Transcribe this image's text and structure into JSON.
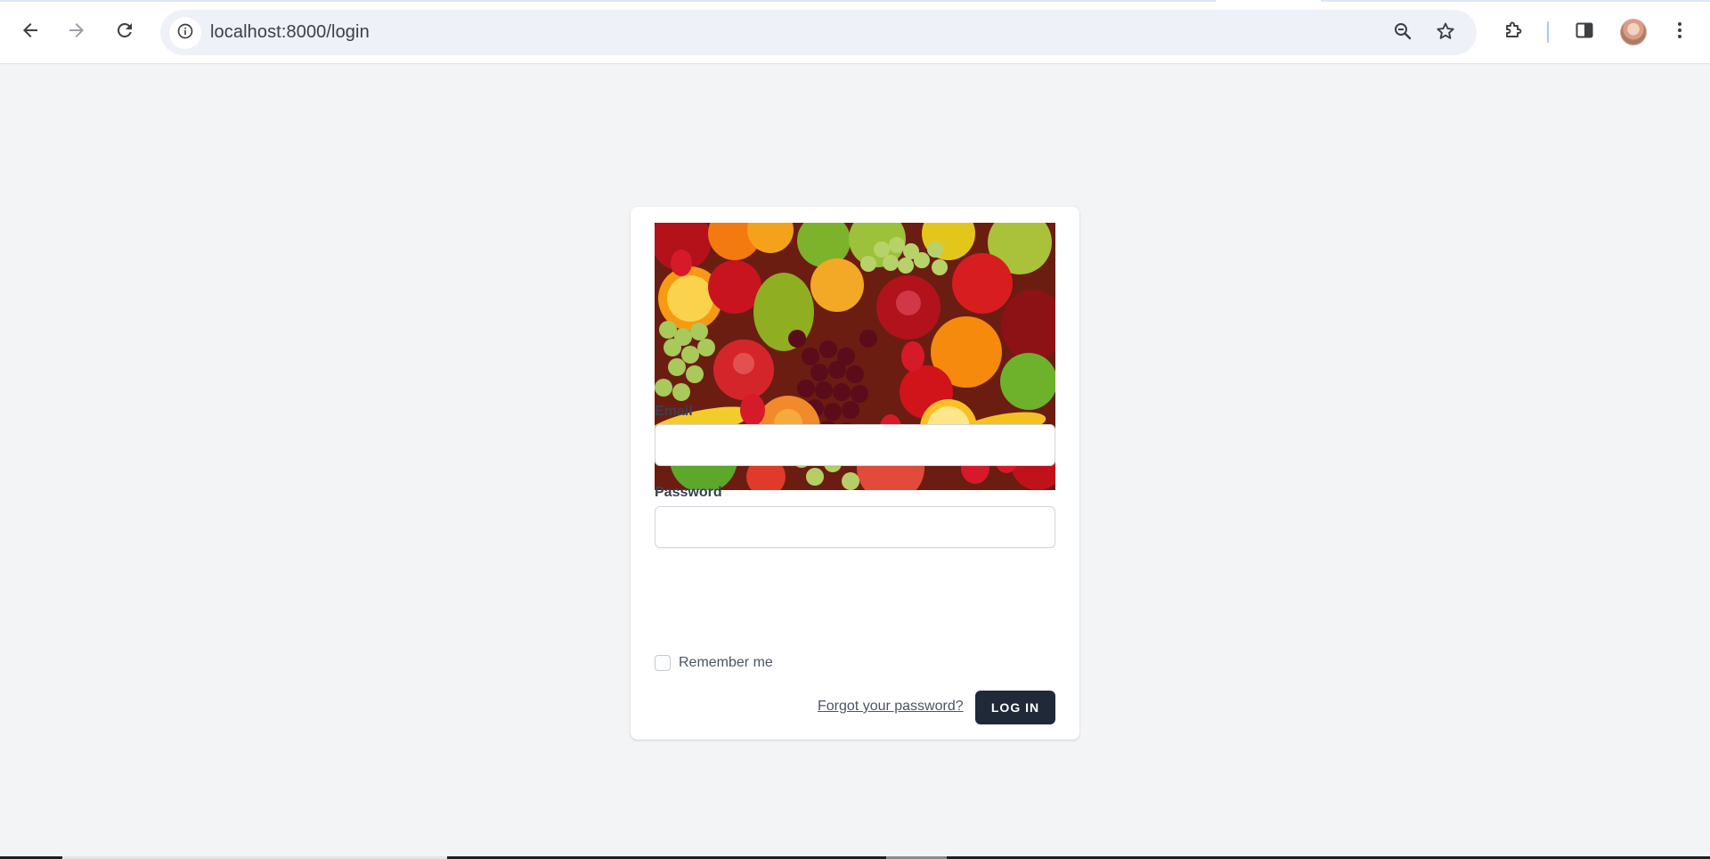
{
  "browser": {
    "url": "localhost:8000/login",
    "icons": {
      "back": "arrow-left-icon",
      "forward": "arrow-right-icon",
      "reload": "reload-icon",
      "site_info": "info-icon",
      "zoom": "zoom-icon",
      "bookmark": "star-icon",
      "extensions": "puzzle-icon",
      "side_panel": "side-panel-icon",
      "menu": "kebab-menu-icon"
    },
    "accent": "#a8c7fa"
  },
  "login": {
    "image_alt": "Assorted fruit",
    "email_label": "Email",
    "email_value": "",
    "password_label": "Password",
    "password_value": "",
    "remember_label": "Remember me",
    "remember_checked": false,
    "forgot_link": "Forgot your password?",
    "submit_label": "LOG IN"
  },
  "colors": {
    "page_background": "#f3f4f6",
    "button_background": "#1f2937",
    "button_text": "#ffffff"
  }
}
